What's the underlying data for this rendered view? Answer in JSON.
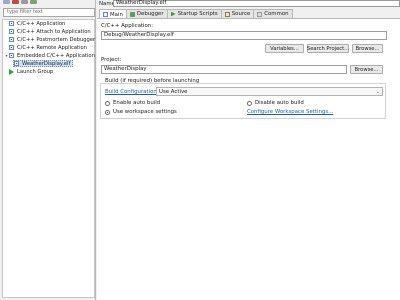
{
  "left": {
    "filter_placeholder": "type filter text",
    "tree": [
      {
        "label": "C/C++ Application",
        "icon": "c-icon"
      },
      {
        "label": "C/C++ Attach to Application",
        "icon": "c-icon"
      },
      {
        "label": "C/C++ Postmortem Debugger",
        "icon": "c-icon"
      },
      {
        "label": "C/C++ Remote Application",
        "icon": "c-icon"
      },
      {
        "label": "Embedded C/C++ Application",
        "icon": "c-icon",
        "expanded": true
      },
      {
        "label": "WeatherDisplay.elf",
        "icon": "c-icon",
        "selected": true
      },
      {
        "label": "Launch Group",
        "icon": "launch-icon"
      }
    ]
  },
  "right": {
    "name_label": "Name:",
    "name_value": "WeatherDisplay.elf",
    "tabs": [
      {
        "label": "Main",
        "active": true
      },
      {
        "label": "Debugger"
      },
      {
        "label": "Startup Scripts"
      },
      {
        "label": "Source"
      },
      {
        "label": "Common"
      }
    ],
    "main": {
      "app_label": "C/C++ Application:",
      "app_value": "Debug/WeatherDisplay.elf",
      "variables_btn": "Variables...",
      "search_project_btn": "Search Project...",
      "browse_btn1": "Browse...",
      "project_label": "Project:",
      "project_value": "WeatherDisplay",
      "browse_btn2": "Browse...",
      "build_label": "Build (if required) before launching",
      "build_config_link": "Build Configuration:",
      "build_config_value": "Use Active",
      "enable_auto_build": "Enable auto build",
      "disable_auto_build": "Disable auto build",
      "use_workspace_settings": "Use workspace settings",
      "configure_link": "Configure Workspace Settings...",
      "selected_build_option": "use_workspace_settings"
    }
  },
  "colors": {
    "link": "#1d5fb5",
    "selection": "#cfe3f7"
  }
}
